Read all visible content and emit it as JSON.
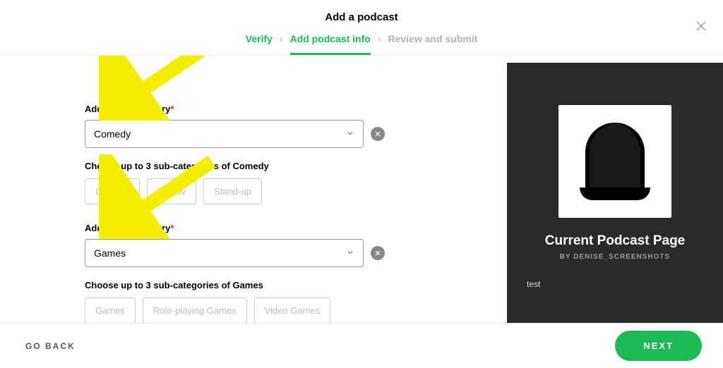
{
  "header": {
    "title": "Add a podcast"
  },
  "steps": {
    "verify": "Verify",
    "add_info": "Add podcast info",
    "review": "Review and submit"
  },
  "category1": {
    "label": "Additional category",
    "required": "*",
    "value": "Comedy",
    "sub_label": "Choose up to 3 sub-categories of Comedy",
    "subs": [
      "Comedy",
      "Improv",
      "Stand-up"
    ]
  },
  "category2": {
    "label": "Additional category",
    "required": "*",
    "value": "Games",
    "sub_label": "Choose up to 3 sub-categories of Games",
    "subs": [
      "Games",
      "Role-playing Games",
      "Video Games"
    ]
  },
  "preview": {
    "title": "Current Podcast Page",
    "byline": "BY DENISE_SCREENSHOTS",
    "desc": "test"
  },
  "footer": {
    "back": "GO BACK",
    "next": "NEXT"
  }
}
